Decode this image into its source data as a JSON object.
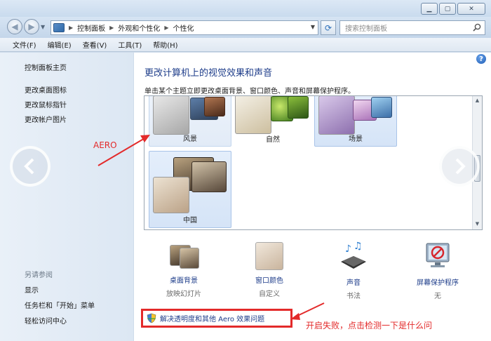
{
  "window": {
    "buttons": [
      "minimize",
      "maximize",
      "close"
    ]
  },
  "nav": {
    "breadcrumb": [
      "控制面板",
      "外观和个性化",
      "个性化"
    ],
    "search_placeholder": "搜索控制面板"
  },
  "menu": [
    "文件(F)",
    "编辑(E)",
    "查看(V)",
    "工具(T)",
    "帮助(H)"
  ],
  "sidebar": {
    "home": "控制面板主页",
    "links": [
      "更改桌面图标",
      "更改鼠标指针",
      "更改帐户图片"
    ],
    "see_also_title": "另请参阅",
    "see_also": [
      "显示",
      "任务栏和「开始」菜单",
      "轻松访问中心"
    ]
  },
  "main": {
    "title": "更改计算机上的视觉效果和声音",
    "instruction": "单击某个主题立即更改桌面背景、窗口颜色、声音和屏幕保护程序。",
    "themes": [
      {
        "name": "风景",
        "state": "hover"
      },
      {
        "name": "自然",
        "state": "normal"
      },
      {
        "name": "场景",
        "state": "selected"
      },
      {
        "name": "中国",
        "state": "selected"
      }
    ],
    "options": [
      {
        "label": "桌面背景",
        "value": "放映幻灯片",
        "icon": "desktop-background-icon"
      },
      {
        "label": "窗口颜色",
        "value": "自定义",
        "icon": "window-color-icon"
      },
      {
        "label": "声音",
        "value": "书法",
        "icon": "sound-icon"
      },
      {
        "label": "屏幕保护程序",
        "value": "无",
        "icon": "screensaver-icon"
      }
    ],
    "troubleshoot_link": "解决透明度和其他 Aero 效果问题"
  },
  "annotations": {
    "aero_label": "AERO",
    "failure_note": "开启失败，点击检测一下是什么问"
  },
  "colors": {
    "annotation_red": "#e32a2a",
    "link_blue": "#1e3d8a"
  }
}
